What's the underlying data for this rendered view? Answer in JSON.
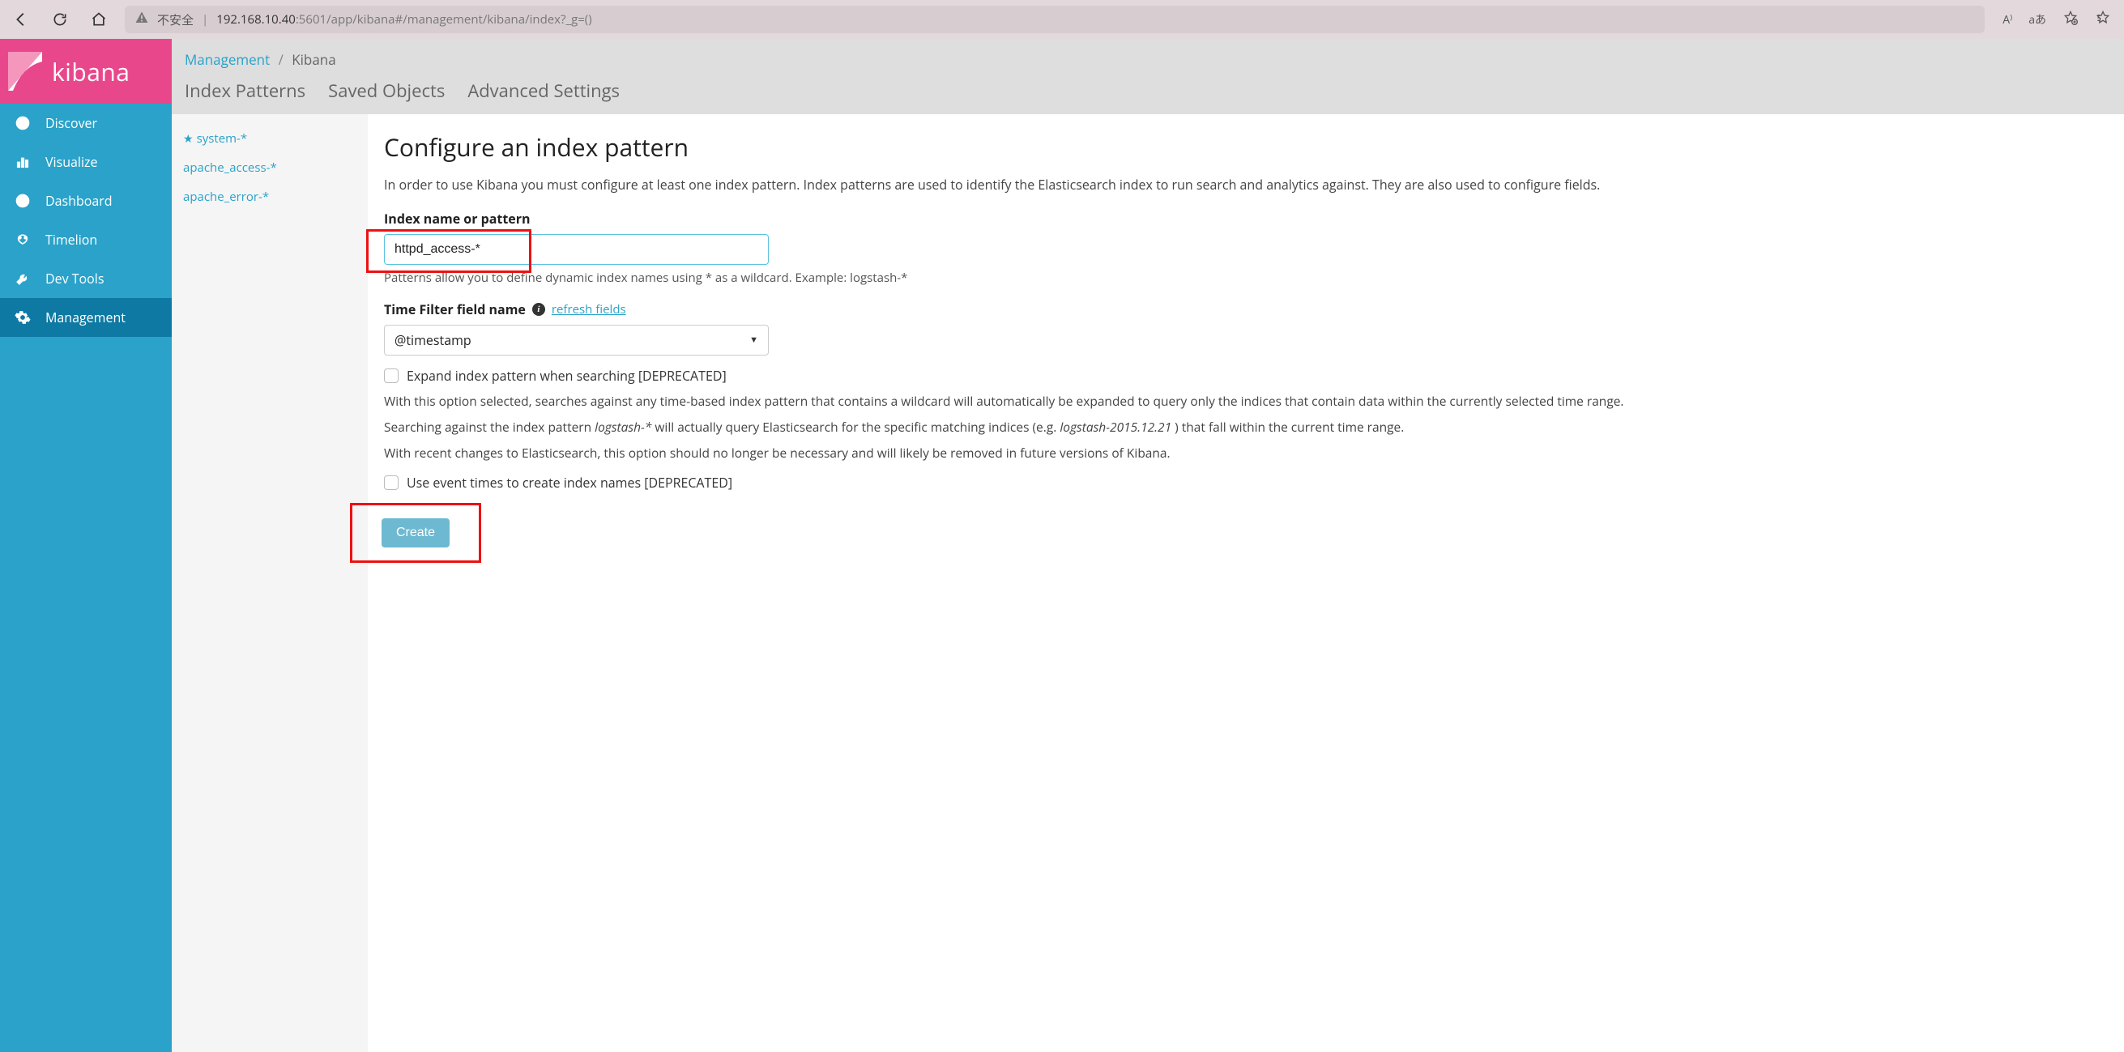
{
  "browser": {
    "warn_label": "不安全",
    "url_host": "192.168.10.40",
    "url_port_path": ":5601/app/kibana#/management/kibana/index?_g=()",
    "read_aloud": "A⁾",
    "translate": "aあ"
  },
  "brand": {
    "name": "kibana"
  },
  "nav": {
    "items": [
      {
        "label": "Discover"
      },
      {
        "label": "Visualize"
      },
      {
        "label": "Dashboard"
      },
      {
        "label": "Timelion"
      },
      {
        "label": "Dev Tools"
      },
      {
        "label": "Management"
      }
    ]
  },
  "breadcrumb": {
    "root": "Management",
    "current": "Kibana"
  },
  "tabs": [
    {
      "label": "Index Patterns"
    },
    {
      "label": "Saved Objects"
    },
    {
      "label": "Advanced Settings"
    }
  ],
  "patternList": [
    {
      "label": "system-*",
      "default": true
    },
    {
      "label": "apache_access-*",
      "default": false
    },
    {
      "label": "apache_error-*",
      "default": false
    }
  ],
  "form": {
    "title": "Configure an index pattern",
    "desc": "In order to use Kibana you must configure at least one index pattern. Index patterns are used to identify the Elasticsearch index to run search and analytics against. They are also used to configure fields.",
    "index_label": "Index name or pattern",
    "index_value": "httpd_access-*",
    "index_hint": "Patterns allow you to define dynamic index names using * as a wildcard. Example: logstash-*",
    "time_label": "Time Filter field name",
    "refresh_link": "refresh fields",
    "time_value": "@timestamp",
    "expand_label": "Expand index pattern when searching [DEPRECATED]",
    "expand_help1_a": "With this option selected, searches against any time-based index pattern that contains a wildcard will automatically be expanded to query only the indices that contain data within the currently selected time range.",
    "expand_help2_a": "Searching against the index pattern ",
    "expand_help2_em1": "logstash-*",
    "expand_help2_b": " will actually query Elasticsearch for the specific matching indices (e.g. ",
    "expand_help2_em2": "logstash-2015.12.21",
    "expand_help2_c": " ) that fall within the current time range.",
    "expand_help3": "With recent changes to Elasticsearch, this option should no longer be necessary and will likely be removed in future versions of Kibana.",
    "event_times_label": "Use event times to create index names [DEPRECATED]",
    "create_label": "Create"
  }
}
